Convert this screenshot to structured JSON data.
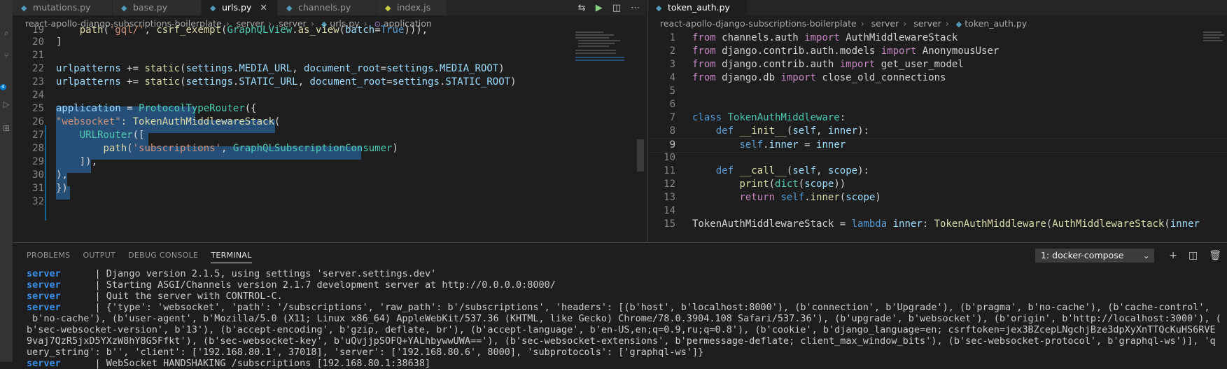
{
  "left_pane": {
    "tabs": [
      {
        "label": "mutations.py",
        "icon": "python-file-icon"
      },
      {
        "label": "base.py",
        "icon": "python-file-icon"
      },
      {
        "label": "urls.py",
        "icon": "python-file-icon",
        "active": true
      },
      {
        "label": "channels.py",
        "icon": "python-file-icon"
      },
      {
        "label": "index.js",
        "icon": "js-file-icon"
      }
    ],
    "close_glyph": "✕",
    "breadcrumb": [
      "react-apollo-django-subscriptions-boilerplate",
      "server",
      "server",
      "urls.py",
      "application"
    ],
    "line_numbers": [
      "19",
      "20",
      "21",
      "22",
      "23",
      "24",
      "25",
      "26",
      "27",
      "28",
      "29",
      "30",
      "31",
      "32"
    ]
  },
  "right_pane": {
    "tabs": [
      {
        "label": "token_auth.py",
        "icon": "python-file-icon",
        "active": true
      }
    ],
    "breadcrumb": [
      "react-apollo-django-subscriptions-boilerplate",
      "server",
      "server",
      "token_auth.py"
    ],
    "line_numbers": [
      "1",
      "2",
      "3",
      "4",
      "5",
      "6",
      "7",
      "8",
      "9",
      "10",
      "11",
      "12",
      "13",
      "14",
      "15"
    ]
  },
  "panel": {
    "tabs": [
      "PROBLEMS",
      "OUTPUT",
      "DEBUG CONSOLE",
      "TERMINAL"
    ],
    "active_tab": "TERMINAL",
    "terminal_select": "1: docker-compose",
    "terminal_lines": [
      {
        "svc": "server",
        "text": "      | Django version 2.1.5, using settings 'server.settings.dev'"
      },
      {
        "svc": "server",
        "text": "      | Starting ASGI/Channels version 2.1.7 development server at http://0.0.0.0:8000/"
      },
      {
        "svc": "server",
        "text": "      | Quit the server with CONTROL-C."
      },
      {
        "svc": "server",
        "text": "      | {'type': 'websocket', 'path': '/subscriptions', 'raw_path': b'/subscriptions', 'headers': [(b'host', b'localhost:8000'), (b'connection', b'Upgrade'), (b'pragma', b'no-cache'), (b'cache-control',"
      },
      {
        "svc": "",
        "text": " b'no-cache'), (b'user-agent', b'Mozilla/5.0 (X11; Linux x86_64) AppleWebKit/537.36 (KHTML, like Gecko) Chrome/78.0.3904.108 Safari/537.36'), (b'upgrade', b'websocket'), (b'origin', b'http://localhost:3000'), ("
      },
      {
        "svc": "",
        "text": "b'sec-websocket-version', b'13'), (b'accept-encoding', b'gzip, deflate, br'), (b'accept-language', b'en-US,en;q=0.9,ru;q=0.8'), (b'cookie', b'django_language=en; csrftoken=jex3BZcepLNgchjBze3dpXyXnTTQcKuHS6RVE"
      },
      {
        "svc": "",
        "text": "9vaj7QzR5jxD5YXzW8hY8G5Ffkt'), (b'sec-websocket-key', b'uQvjjpSOFQ+YALhbywwUWA=='), (b'sec-websocket-extensions', b'permessage-deflate; client_max_window_bits'), (b'sec-websocket-protocol', b'graphql-ws')], 'q"
      },
      {
        "svc": "",
        "text": "uery_string': b'', 'client': ['192.168.80.1', 37018], 'server': ['192.168.80.6', 8000], 'subprotocols': ['graphql-ws']}"
      },
      {
        "svc": "server",
        "text": "      | WebSocket HANDSHAKING /subscriptions [192.168.80.1:38638]"
      }
    ]
  },
  "activity_badge": "4",
  "colors": {
    "accent": "#007acc",
    "selection": "#264f78",
    "keyword": "#c586c0",
    "string": "#ce9178"
  }
}
